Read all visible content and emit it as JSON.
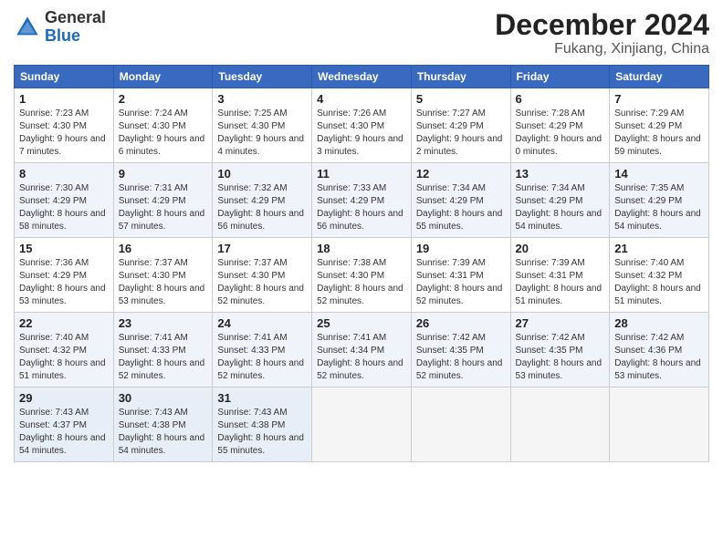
{
  "header": {
    "logo_general": "General",
    "logo_blue": "Blue",
    "month": "December 2024",
    "location": "Fukang, Xinjiang, China"
  },
  "weekdays": [
    "Sunday",
    "Monday",
    "Tuesday",
    "Wednesday",
    "Thursday",
    "Friday",
    "Saturday"
  ],
  "weeks": [
    [
      {
        "day": "1",
        "sunrise": "7:23 AM",
        "sunset": "4:30 PM",
        "daylight": "9 hours and 7 minutes."
      },
      {
        "day": "2",
        "sunrise": "7:24 AM",
        "sunset": "4:30 PM",
        "daylight": "9 hours and 6 minutes."
      },
      {
        "day": "3",
        "sunrise": "7:25 AM",
        "sunset": "4:30 PM",
        "daylight": "9 hours and 4 minutes."
      },
      {
        "day": "4",
        "sunrise": "7:26 AM",
        "sunset": "4:30 PM",
        "daylight": "9 hours and 3 minutes."
      },
      {
        "day": "5",
        "sunrise": "7:27 AM",
        "sunset": "4:29 PM",
        "daylight": "9 hours and 2 minutes."
      },
      {
        "day": "6",
        "sunrise": "7:28 AM",
        "sunset": "4:29 PM",
        "daylight": "9 hours and 0 minutes."
      },
      {
        "day": "7",
        "sunrise": "7:29 AM",
        "sunset": "4:29 PM",
        "daylight": "8 hours and 59 minutes."
      }
    ],
    [
      {
        "day": "8",
        "sunrise": "7:30 AM",
        "sunset": "4:29 PM",
        "daylight": "8 hours and 58 minutes."
      },
      {
        "day": "9",
        "sunrise": "7:31 AM",
        "sunset": "4:29 PM",
        "daylight": "8 hours and 57 minutes."
      },
      {
        "day": "10",
        "sunrise": "7:32 AM",
        "sunset": "4:29 PM",
        "daylight": "8 hours and 56 minutes."
      },
      {
        "day": "11",
        "sunrise": "7:33 AM",
        "sunset": "4:29 PM",
        "daylight": "8 hours and 56 minutes."
      },
      {
        "day": "12",
        "sunrise": "7:34 AM",
        "sunset": "4:29 PM",
        "daylight": "8 hours and 55 minutes."
      },
      {
        "day": "13",
        "sunrise": "7:34 AM",
        "sunset": "4:29 PM",
        "daylight": "8 hours and 54 minutes."
      },
      {
        "day": "14",
        "sunrise": "7:35 AM",
        "sunset": "4:29 PM",
        "daylight": "8 hours and 54 minutes."
      }
    ],
    [
      {
        "day": "15",
        "sunrise": "7:36 AM",
        "sunset": "4:29 PM",
        "daylight": "8 hours and 53 minutes."
      },
      {
        "day": "16",
        "sunrise": "7:37 AM",
        "sunset": "4:30 PM",
        "daylight": "8 hours and 53 minutes."
      },
      {
        "day": "17",
        "sunrise": "7:37 AM",
        "sunset": "4:30 PM",
        "daylight": "8 hours and 52 minutes."
      },
      {
        "day": "18",
        "sunrise": "7:38 AM",
        "sunset": "4:30 PM",
        "daylight": "8 hours and 52 minutes."
      },
      {
        "day": "19",
        "sunrise": "7:39 AM",
        "sunset": "4:31 PM",
        "daylight": "8 hours and 52 minutes."
      },
      {
        "day": "20",
        "sunrise": "7:39 AM",
        "sunset": "4:31 PM",
        "daylight": "8 hours and 51 minutes."
      },
      {
        "day": "21",
        "sunrise": "7:40 AM",
        "sunset": "4:32 PM",
        "daylight": "8 hours and 51 minutes."
      }
    ],
    [
      {
        "day": "22",
        "sunrise": "7:40 AM",
        "sunset": "4:32 PM",
        "daylight": "8 hours and 51 minutes."
      },
      {
        "day": "23",
        "sunrise": "7:41 AM",
        "sunset": "4:33 PM",
        "daylight": "8 hours and 52 minutes."
      },
      {
        "day": "24",
        "sunrise": "7:41 AM",
        "sunset": "4:33 PM",
        "daylight": "8 hours and 52 minutes."
      },
      {
        "day": "25",
        "sunrise": "7:41 AM",
        "sunset": "4:34 PM",
        "daylight": "8 hours and 52 minutes."
      },
      {
        "day": "26",
        "sunrise": "7:42 AM",
        "sunset": "4:35 PM",
        "daylight": "8 hours and 52 minutes."
      },
      {
        "day": "27",
        "sunrise": "7:42 AM",
        "sunset": "4:35 PM",
        "daylight": "8 hours and 53 minutes."
      },
      {
        "day": "28",
        "sunrise": "7:42 AM",
        "sunset": "4:36 PM",
        "daylight": "8 hours and 53 minutes."
      }
    ],
    [
      {
        "day": "29",
        "sunrise": "7:43 AM",
        "sunset": "4:37 PM",
        "daylight": "8 hours and 54 minutes."
      },
      {
        "day": "30",
        "sunrise": "7:43 AM",
        "sunset": "4:38 PM",
        "daylight": "8 hours and 54 minutes."
      },
      {
        "day": "31",
        "sunrise": "7:43 AM",
        "sunset": "4:38 PM",
        "daylight": "8 hours and 55 minutes."
      },
      null,
      null,
      null,
      null
    ]
  ],
  "labels": {
    "sunrise": "Sunrise:",
    "sunset": "Sunset:",
    "daylight": "Daylight:"
  }
}
